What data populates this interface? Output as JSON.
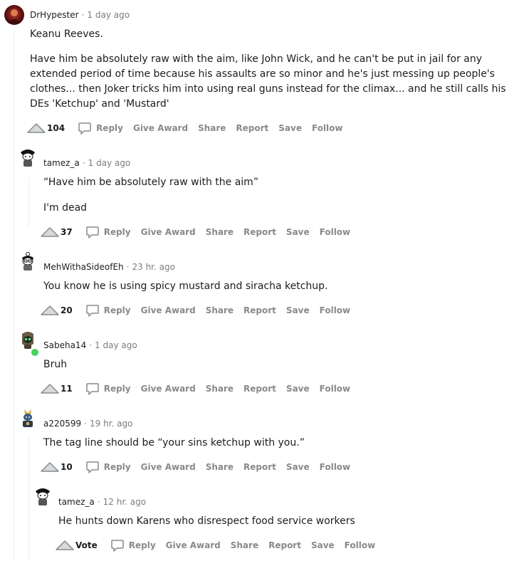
{
  "actions": {
    "reply": "Reply",
    "give_award": "Give Award",
    "share": "Share",
    "report": "Report",
    "save": "Save",
    "follow": "Follow"
  },
  "comments": [
    {
      "user": "DrHypester",
      "time": "1 day ago",
      "paragraphs": [
        "Keanu Reeves.",
        "Have him be absolutely raw with the aim, like John Wick, and he can't be put in jail for any extended period of time because his assaults are so minor and he's just messing up people's clothes... then Joker tricks him into using real guns instead for the climax... and he still calls his DEs 'Ketchup' and 'Mustard'"
      ],
      "score": "104"
    },
    {
      "user": "tamez_a",
      "time": "1 day ago",
      "paragraphs": [
        "“Have him be absolutely raw with the aim”",
        "I'm dead"
      ],
      "score": "37"
    },
    {
      "user": "MehWithaSideofEh",
      "time": "23 hr. ago",
      "paragraphs": [
        "You know he is using spicy mustard and siracha ketchup."
      ],
      "score": "20"
    },
    {
      "user": "Sabeha14",
      "time": "1 day ago",
      "paragraphs": [
        "Bruh"
      ],
      "score": "11"
    },
    {
      "user": "a220599",
      "time": "19 hr. ago",
      "paragraphs": [
        "The tag line should be “your sins ketchup with you.”"
      ],
      "score": "10"
    },
    {
      "user": "tamez_a",
      "time": "12 hr. ago",
      "paragraphs": [
        "He hunts down Karens who disrespect food service workers"
      ],
      "score": "Vote"
    }
  ]
}
